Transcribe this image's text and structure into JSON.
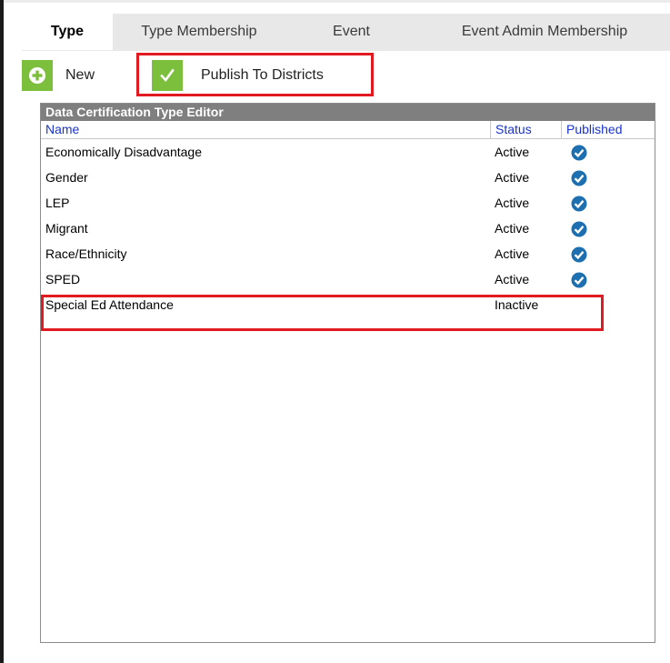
{
  "tabs": [
    {
      "label": "Type",
      "active": true
    },
    {
      "label": "Type Membership",
      "active": false
    },
    {
      "label": "Event",
      "active": false
    },
    {
      "label": "Event Admin Membership",
      "active": false
    }
  ],
  "toolbar": {
    "new_label": "New",
    "publish_label": "Publish To Districts"
  },
  "grid": {
    "title": "Data Certification Type Editor",
    "columns": {
      "name": "Name",
      "status": "Status",
      "published": "Published"
    },
    "rows": [
      {
        "name": "Economically Disadvantage",
        "status": "Active",
        "published": true
      },
      {
        "name": "Gender",
        "status": "Active",
        "published": true
      },
      {
        "name": "LEP",
        "status": "Active",
        "published": true
      },
      {
        "name": "Migrant",
        "status": "Active",
        "published": true
      },
      {
        "name": "Race/Ethnicity",
        "status": "Active",
        "published": true
      },
      {
        "name": "SPED",
        "status": "Active",
        "published": true
      },
      {
        "name": "Special Ed Attendance",
        "status": "Inactive",
        "published": false
      }
    ]
  },
  "colors": {
    "accent_green": "#7cbf3c",
    "highlight_red": "#e11a22",
    "header_link_blue": "#1a33cc",
    "check_blue": "#1e6fb0"
  },
  "icons": {
    "new": "plus-circle-icon",
    "publish": "check-icon",
    "published": "check-badge-icon"
  }
}
